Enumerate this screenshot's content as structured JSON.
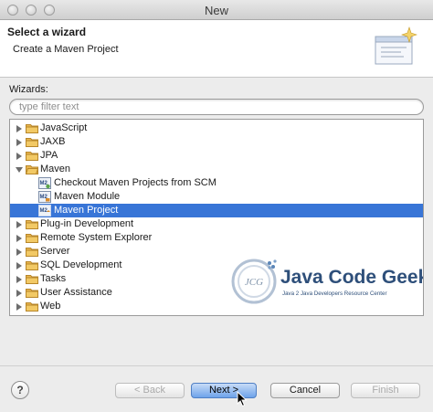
{
  "window": {
    "title": "New"
  },
  "header": {
    "title": "Select a wizard",
    "description": "Create a Maven Project"
  },
  "wizards": {
    "label": "Wizards:",
    "filter_placeholder": "type filter text",
    "items": [
      {
        "label": "JavaScript",
        "icon": "folder-icon",
        "state": "collapsed"
      },
      {
        "label": "JAXB",
        "icon": "folder-icon",
        "state": "collapsed"
      },
      {
        "label": "JPA",
        "icon": "folder-icon",
        "state": "collapsed"
      },
      {
        "label": "Maven",
        "icon": "folder-icon",
        "state": "expanded"
      },
      {
        "label": "Checkout Maven Projects from SCM",
        "icon": "maven-checkout-icon",
        "state": "leaf"
      },
      {
        "label": "Maven Module",
        "icon": "maven-module-icon",
        "state": "leaf"
      },
      {
        "label": "Maven Project",
        "icon": "maven-project-icon",
        "state": "leaf",
        "selected": true
      },
      {
        "label": "Plug-in Development",
        "icon": "folder-icon",
        "state": "collapsed"
      },
      {
        "label": "Remote System Explorer",
        "icon": "folder-icon",
        "state": "collapsed"
      },
      {
        "label": "Server",
        "icon": "folder-icon",
        "state": "collapsed"
      },
      {
        "label": "SQL Development",
        "icon": "folder-icon",
        "state": "collapsed"
      },
      {
        "label": "Tasks",
        "icon": "folder-icon",
        "state": "collapsed"
      },
      {
        "label": "User Assistance",
        "icon": "folder-icon",
        "state": "collapsed"
      },
      {
        "label": "Web",
        "icon": "folder-icon",
        "state": "collapsed"
      }
    ]
  },
  "watermark": {
    "title": "Java Code Geeks",
    "subtitle": "Java 2 Java Developers Resource Center",
    "logo_text": "JCG"
  },
  "buttons": {
    "help": "?",
    "back": "< Back",
    "next": "Next >",
    "cancel": "Cancel",
    "finish": "Finish"
  },
  "colors": {
    "selection": "#3875d7",
    "folder": "#e6b24a"
  }
}
